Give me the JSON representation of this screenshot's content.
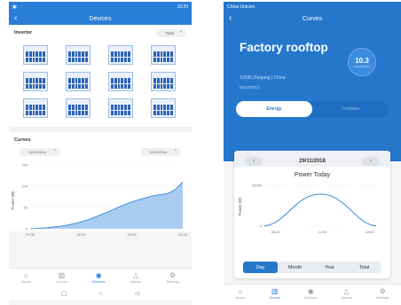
{
  "left": {
    "status": {
      "time": "10:20"
    },
    "header": {
      "title": "Devices"
    },
    "devices": {
      "title": "Inverter",
      "filter": "Total",
      "panels": [
        "",
        "",
        "",
        "",
        "",
        "",
        "",
        "",
        "",
        "",
        "",
        ""
      ]
    },
    "curves": {
      "title": "Curves",
      "start_date": "11/20/2018",
      "end_date": "11/21/2018"
    },
    "chart_data": {
      "type": "area",
      "ylabel": "Power (W)",
      "yticks": [
        "150",
        "100",
        "50",
        "0"
      ],
      "xticks": [
        "07:00",
        "08:00",
        "09:00",
        "10:00"
      ],
      "ylim": [
        0,
        150
      ],
      "x": [
        0,
        0.05,
        0.1,
        0.15,
        0.2,
        0.25,
        0.3,
        0.35,
        0.4,
        0.45,
        0.5,
        0.55,
        0.6,
        0.65,
        0.7,
        0.75,
        0.8,
        0.85,
        0.9,
        0.93,
        0.96,
        1.0
      ],
      "values": [
        0,
        1,
        2,
        4,
        6,
        9,
        13,
        18,
        24,
        31,
        38,
        46,
        54,
        61,
        67,
        72,
        77,
        80,
        83,
        88,
        95,
        110
      ]
    },
    "nav": [
      {
        "label": "Home",
        "icon": "home-icon",
        "glyph": "⌂",
        "active": false
      },
      {
        "label": "Curves",
        "icon": "chart-icon",
        "glyph": "▥",
        "active": false
      },
      {
        "label": "Devices",
        "icon": "device-icon",
        "glyph": "◉",
        "active": true
      },
      {
        "label": "Alarms",
        "icon": "alarm-icon",
        "glyph": "△",
        "active": false
      },
      {
        "label": "Settings",
        "icon": "gear-icon",
        "glyph": "⚙",
        "active": false
      }
    ]
  },
  "right": {
    "status": {
      "carrier": "China Unicom"
    },
    "header": {
      "title": "Curves"
    },
    "plant": {
      "name": "Factory rooftop",
      "capacity": "10.3",
      "capacity_label": "Capacity(kWp)",
      "address": "12696 Zhejiang | China",
      "date": "04/27/2017"
    },
    "toggle": {
      "energy": "Energy",
      "compare": "Compare"
    },
    "date": "29/11/2018",
    "chart_data": {
      "type": "line",
      "title": "Power Today",
      "ylabel": "Power (W)",
      "yticks": [
        "20000",
        "0"
      ],
      "xticks": [
        "08:00",
        "12:00",
        "16:00"
      ],
      "ylim": [
        0,
        20000
      ],
      "x": [
        0,
        0.05,
        0.1,
        0.15,
        0.2,
        0.25,
        0.3,
        0.35,
        0.4,
        0.45,
        0.5,
        0.55,
        0.6,
        0.65,
        0.7,
        0.75,
        0.8,
        0.85,
        0.9,
        0.95,
        1.0
      ],
      "values": [
        0,
        600,
        1800,
        3800,
        6200,
        8800,
        11200,
        13200,
        14600,
        15400,
        15700,
        15500,
        14700,
        13300,
        11400,
        9000,
        6400,
        3900,
        1900,
        600,
        0
      ]
    },
    "period_tabs": [
      {
        "label": "Day",
        "active": true
      },
      {
        "label": "Month",
        "active": false
      },
      {
        "label": "Year",
        "active": false
      },
      {
        "label": "Total",
        "active": false
      }
    ],
    "nav": [
      {
        "label": "Home",
        "icon": "home-icon",
        "glyph": "⌂",
        "active": false
      },
      {
        "label": "Curves",
        "icon": "chart-icon",
        "glyph": "▥",
        "active": true
      },
      {
        "label": "Devices",
        "icon": "device-icon",
        "glyph": "◉",
        "active": false
      },
      {
        "label": "Alarms",
        "icon": "alarm-icon",
        "glyph": "△",
        "active": false
      },
      {
        "label": "Settings",
        "icon": "gear-icon",
        "glyph": "⚙",
        "active": false
      }
    ]
  }
}
